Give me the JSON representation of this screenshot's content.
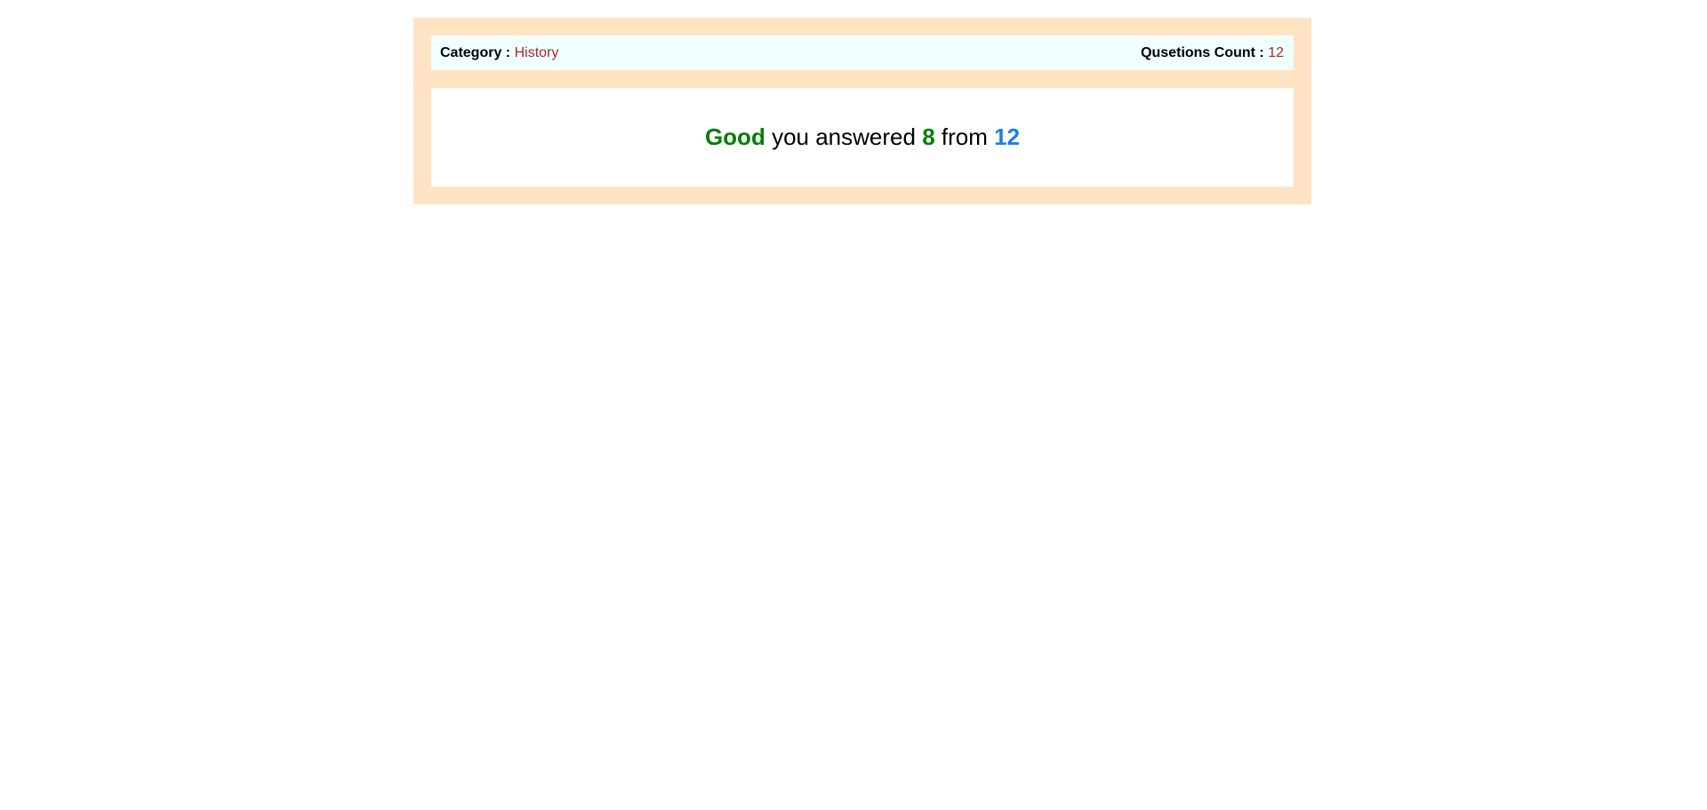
{
  "header": {
    "category_label": "Category :",
    "category_value": "History",
    "count_label": "Qusetions Count :",
    "count_value": "12"
  },
  "result": {
    "rating": "Good",
    "text_before": "you answered",
    "correct": "8",
    "text_middle": "from",
    "total": "12"
  },
  "colors": {
    "outer_background": "#ffe4c4",
    "info_bar_background": "#f0ffff",
    "value_accent": "#a52a2a",
    "rating_green": "#008000",
    "total_blue": "#1e7ee8"
  }
}
